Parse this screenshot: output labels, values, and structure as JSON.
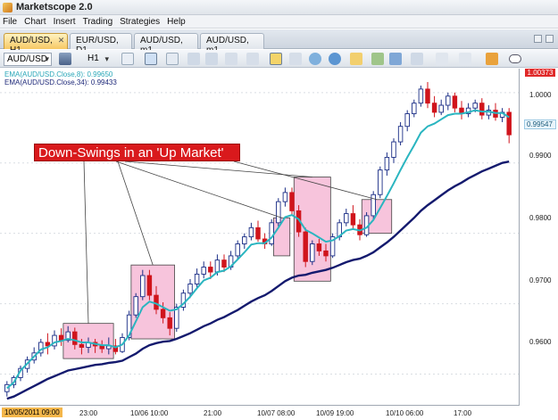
{
  "app": {
    "title": "Marketscope 2.0"
  },
  "menu": [
    "File",
    "Chart",
    "Insert",
    "Trading",
    "Strategies",
    "Help"
  ],
  "tabs": [
    {
      "label": "AUD/USD, H1",
      "active": true
    },
    {
      "label": "EUR/USD, D1",
      "active": false
    },
    {
      "label": "AUD/USD, m1",
      "active": false
    },
    {
      "label": "AUD/USD, m1",
      "active": false
    }
  ],
  "toolbar": {
    "symbol": "AUD/USD",
    "timeframe": "H1"
  },
  "indicators": {
    "ema_fast": {
      "label": "EMA(AUD/USD.Close,8): 0.99650",
      "color": "#2ab5c0"
    },
    "ema_slow": {
      "label": "EMA(AUD/USD.Close,34): 0.99433",
      "color": "#141a6e"
    }
  },
  "annotation": {
    "text": "Down-Swings in an 'Up Market'"
  },
  "price_axis": {
    "top_badge": "1.00373",
    "current_price": "0.99547",
    "ticks": [
      "1.0000",
      "0.9900",
      "0.9800",
      "0.9700",
      "0.9600"
    ]
  },
  "time_axis": {
    "first": "10/05/2011 09:00",
    "ticks": [
      "23:00",
      "10/06 10:00",
      "21:00",
      "10/07 08:00",
      "10/09 19:00",
      "10/10 06:00",
      "17:00"
    ]
  },
  "chart_data": {
    "type": "candlestick",
    "title": "",
    "xlabel": "",
    "ylabel": "",
    "ylim": [
      0.9555,
      1.0034
    ],
    "colors": {
      "up": "#1a2d86",
      "down": "#d0141c",
      "ema_fast": "#2ab5c0",
      "ema_slow": "#141a6e"
    },
    "candles": [
      [
        0.9575,
        0.959,
        0.9568,
        0.9585
      ],
      [
        0.9585,
        0.9598,
        0.958,
        0.9595
      ],
      [
        0.9595,
        0.9612,
        0.959,
        0.9608
      ],
      [
        0.9608,
        0.9625,
        0.9602,
        0.962
      ],
      [
        0.962,
        0.9638,
        0.9615,
        0.963
      ],
      [
        0.963,
        0.965,
        0.9625,
        0.9645
      ],
      [
        0.9645,
        0.9658,
        0.9628,
        0.964
      ],
      [
        0.964,
        0.9662,
        0.9635,
        0.9655
      ],
      [
        0.9655,
        0.9665,
        0.964,
        0.9648
      ],
      [
        0.9648,
        0.9668,
        0.9645,
        0.966
      ],
      [
        0.966,
        0.9666,
        0.9635,
        0.9642
      ],
      [
        0.9642,
        0.965,
        0.9628,
        0.9638
      ],
      [
        0.9638,
        0.9652,
        0.963,
        0.9645
      ],
      [
        0.9645,
        0.965,
        0.963,
        0.964
      ],
      [
        0.964,
        0.9648,
        0.963,
        0.9636
      ],
      [
        0.9636,
        0.9652,
        0.9628,
        0.964
      ],
      [
        0.964,
        0.965,
        0.9628,
        0.9632
      ],
      [
        0.9632,
        0.9658,
        0.963,
        0.9652
      ],
      [
        0.9652,
        0.969,
        0.9648,
        0.9684
      ],
      [
        0.9684,
        0.9715,
        0.968,
        0.971
      ],
      [
        0.971,
        0.9748,
        0.9705,
        0.974
      ],
      [
        0.974,
        0.9748,
        0.9705,
        0.9712
      ],
      [
        0.9712,
        0.9725,
        0.9685,
        0.9692
      ],
      [
        0.9692,
        0.9702,
        0.9672,
        0.968
      ],
      [
        0.968,
        0.9688,
        0.9655,
        0.9665
      ],
      [
        0.9665,
        0.97,
        0.966,
        0.9695
      ],
      [
        0.9695,
        0.972,
        0.969,
        0.9715
      ],
      [
        0.9715,
        0.9735,
        0.9708,
        0.9728
      ],
      [
        0.9728,
        0.975,
        0.9722,
        0.9742
      ],
      [
        0.9742,
        0.976,
        0.9736,
        0.9752
      ],
      [
        0.9752,
        0.976,
        0.9735,
        0.9745
      ],
      [
        0.9745,
        0.977,
        0.974,
        0.9762
      ],
      [
        0.9762,
        0.977,
        0.9745,
        0.9752
      ],
      [
        0.9752,
        0.9775,
        0.9748,
        0.9768
      ],
      [
        0.9768,
        0.979,
        0.9762,
        0.9785
      ],
      [
        0.9785,
        0.98,
        0.9778,
        0.9795
      ],
      [
        0.9795,
        0.9815,
        0.979,
        0.9808
      ],
      [
        0.9808,
        0.9818,
        0.9788,
        0.9792
      ],
      [
        0.9792,
        0.98,
        0.9778,
        0.9785
      ],
      [
        0.9785,
        0.982,
        0.9782,
        0.9815
      ],
      [
        0.9815,
        0.985,
        0.981,
        0.9845
      ],
      [
        0.9845,
        0.9865,
        0.9838,
        0.9858
      ],
      [
        0.9858,
        0.9865,
        0.9825,
        0.9832
      ],
      [
        0.9832,
        0.984,
        0.9795,
        0.9802
      ],
      [
        0.9802,
        0.9808,
        0.9752,
        0.976
      ],
      [
        0.976,
        0.979,
        0.9755,
        0.9785
      ],
      [
        0.9785,
        0.9792,
        0.9768,
        0.9775
      ],
      [
        0.9775,
        0.9785,
        0.976,
        0.9768
      ],
      [
        0.9768,
        0.98,
        0.9765,
        0.9795
      ],
      [
        0.9795,
        0.982,
        0.979,
        0.9815
      ],
      [
        0.9815,
        0.9835,
        0.981,
        0.9828
      ],
      [
        0.9828,
        0.984,
        0.9805,
        0.9812
      ],
      [
        0.9812,
        0.982,
        0.979,
        0.9798
      ],
      [
        0.9798,
        0.983,
        0.9795,
        0.9825
      ],
      [
        0.9825,
        0.986,
        0.982,
        0.9855
      ],
      [
        0.9855,
        0.9895,
        0.985,
        0.989
      ],
      [
        0.989,
        0.9915,
        0.9882,
        0.9908
      ],
      [
        0.9908,
        0.9935,
        0.99,
        0.993
      ],
      [
        0.993,
        0.9958,
        0.9925,
        0.9952
      ],
      [
        0.9952,
        0.9975,
        0.9945,
        0.997
      ],
      [
        0.997,
        0.999,
        0.9965,
        0.9985
      ],
      [
        0.9985,
        1.001,
        0.998,
        1.0005
      ],
      [
        1.0005,
        1.0015,
        0.9978,
        0.9985
      ],
      [
        0.9985,
        0.9995,
        0.9965,
        0.9972
      ],
      [
        0.9972,
        0.999,
        0.9968,
        0.9982
      ],
      [
        0.9982,
        1.0,
        0.9975,
        0.9995
      ],
      [
        0.9995,
        1.0,
        0.9972,
        0.9978
      ],
      [
        0.9978,
        0.9988,
        0.9962,
        0.997
      ],
      [
        0.997,
        0.9985,
        0.9965,
        0.9978
      ],
      [
        0.9978,
        0.999,
        0.9972,
        0.9985
      ],
      [
        0.9985,
        0.9992,
        0.9962,
        0.9968
      ],
      [
        0.9968,
        0.9982,
        0.9962,
        0.9975
      ],
      [
        0.9975,
        0.9985,
        0.996,
        0.9965
      ],
      [
        0.9965,
        0.9978,
        0.9958,
        0.9972
      ],
      [
        0.9972,
        0.9978,
        0.9928,
        0.994
      ]
    ],
    "ema_fast": [
      0.958,
      0.9588,
      0.9605,
      0.9615,
      0.9625,
      0.9635,
      0.9638,
      0.9645,
      0.9647,
      0.965,
      0.9648,
      0.9645,
      0.9645,
      0.9643,
      0.9641,
      0.9641,
      0.9638,
      0.9642,
      0.9655,
      0.9675,
      0.9695,
      0.9703,
      0.97,
      0.9695,
      0.969,
      0.9692,
      0.97,
      0.971,
      0.9722,
      0.9733,
      0.9737,
      0.9745,
      0.9747,
      0.9753,
      0.9763,
      0.9773,
      0.9784,
      0.9786,
      0.9786,
      0.9794,
      0.9808,
      0.9823,
      0.9826,
      0.982,
      0.9805,
      0.98,
      0.9794,
      0.9788,
      0.979,
      0.9796,
      0.9804,
      0.9806,
      0.9804,
      0.9808,
      0.9819,
      0.9836,
      0.9853,
      0.9871,
      0.989,
      0.9908,
      0.9925,
      0.9943,
      0.9952,
      0.9956,
      0.9962,
      0.9968,
      0.997,
      0.997,
      0.9972,
      0.9975,
      0.9973,
      0.9973,
      0.9971,
      0.9971,
      0.9965
    ],
    "ema_slow": [
      0.9565,
      0.9568,
      0.9573,
      0.9578,
      0.9583,
      0.9588,
      0.9593,
      0.9597,
      0.9601,
      0.9605,
      0.9607,
      0.9609,
      0.9611,
      0.9613,
      0.9614,
      0.9616,
      0.9617,
      0.9619,
      0.9624,
      0.9629,
      0.9636,
      0.9641,
      0.9644,
      0.9646,
      0.9647,
      0.965,
      0.9654,
      0.9658,
      0.9663,
      0.9668,
      0.9672,
      0.9677,
      0.9681,
      0.9686,
      0.9691,
      0.9697,
      0.9703,
      0.9708,
      0.9712,
      0.9718,
      0.9725,
      0.9732,
      0.9737,
      0.974,
      0.9741,
      0.9744,
      0.9746,
      0.9748,
      0.9751,
      0.9755,
      0.9759,
      0.9762,
      0.9764,
      0.9768,
      0.9773,
      0.978,
      0.9787,
      0.9795,
      0.9804,
      0.9813,
      0.9822,
      0.9832,
      0.984,
      0.9847,
      0.9854,
      0.9861,
      0.9867,
      0.9872,
      0.9878,
      0.9883,
      0.9888,
      0.9892,
      0.9896,
      0.99,
      0.9902
    ]
  }
}
